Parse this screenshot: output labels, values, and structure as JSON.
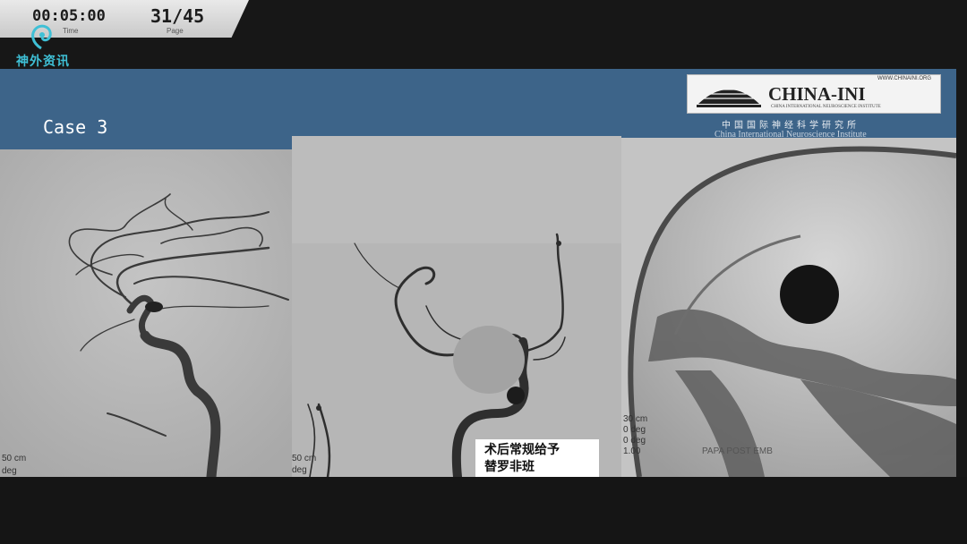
{
  "hud": {
    "time_value": "00:05:00",
    "time_label": "Time",
    "page_value": "31/45",
    "page_label": "Page"
  },
  "logo": {
    "text": "神外资讯"
  },
  "slide": {
    "title": "Case 3",
    "ini": {
      "url": "WWW.CHINAINI.ORG",
      "name": "CHINA-INI",
      "sub": "CHINA INTERNATIONAL NEUROSCIENCE INSTITUTE",
      "cn": "中国国际神经科学研究所",
      "en": "China International Neuroscience Institute"
    },
    "panels": [
      {
        "label_a": "50 cm",
        "label_b": "deg"
      },
      {
        "label_a": "50 cm",
        "label_b": "deg"
      },
      {
        "label_a": "30 cm",
        "label_b": "0 deg",
        "label_c": "0 deg",
        "label_d": "1.00",
        "label_e": "PAPA POST EMB"
      }
    ],
    "note_line1": "术后常规给予",
    "note_line2": "替罗非班"
  },
  "colors": {
    "band": "#3d6489",
    "logo_accent": "#3fc0d6"
  }
}
